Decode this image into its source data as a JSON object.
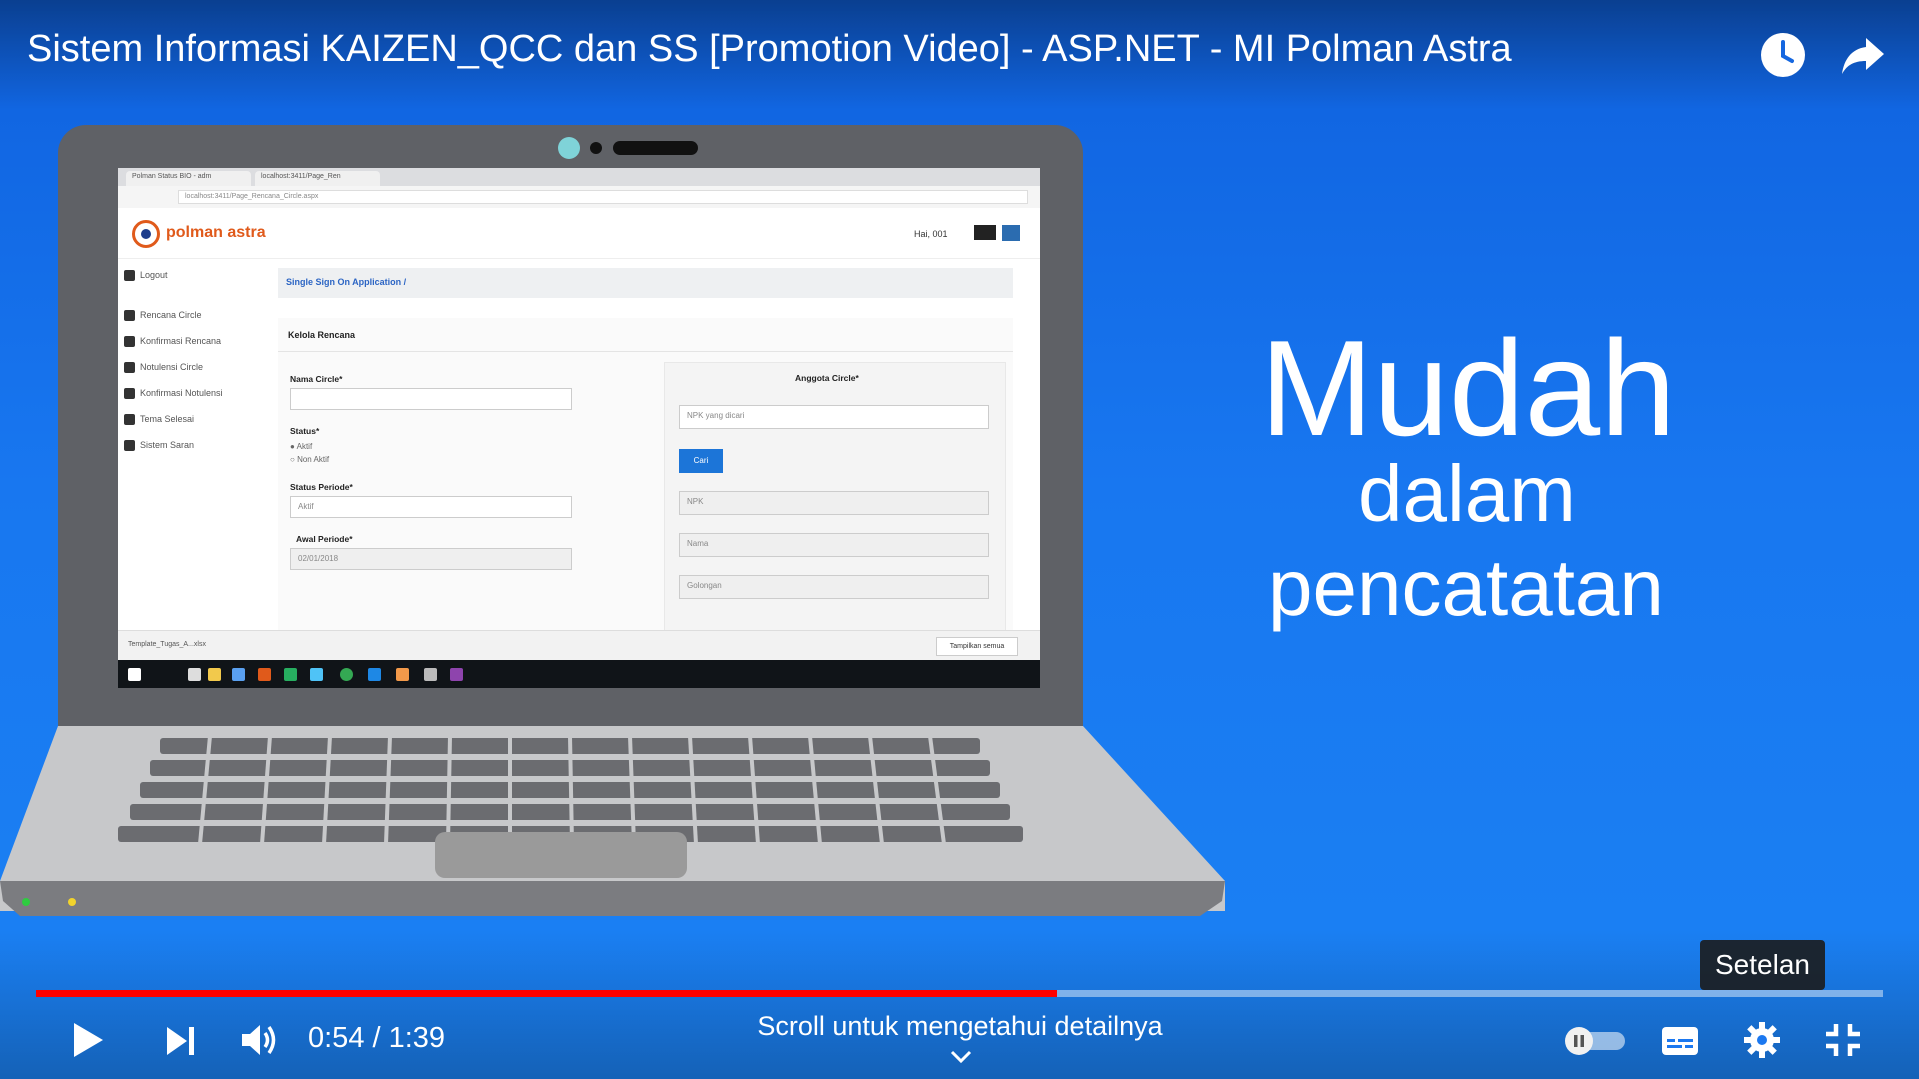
{
  "video": {
    "title": "Sistem Informasi KAIZEN_QCC dan SS [Promotion Video] - ASP.NET - MI Polman Astra",
    "overlay_lines": [
      "Mudah",
      "dalam",
      "pencatatan"
    ]
  },
  "top_actions": {
    "watch_later_icon": "clock-icon",
    "share_icon": "share-icon"
  },
  "screen_app": {
    "browser_tabs": [
      "Polman Status BIO - adm",
      "localhost:3411/Page_Ren"
    ],
    "url": "localhost:3411/Page_Rencana_Circle.aspx",
    "logo_text": "polman astra",
    "user_label": "Hai, 001",
    "sidebar": [
      "Logout",
      "Rencana Circle",
      "Konfirmasi Rencana",
      "Notulensi Circle",
      "Konfirmasi Notulensi",
      "Tema Selesai",
      "Sistem Saran"
    ],
    "breadcrumb": "Single Sign On Application  /",
    "panel_title": "Kelola Rencana",
    "fields": {
      "nama_circle_label": "Nama Circle*",
      "status_label": "Status*",
      "status_options": [
        "Aktif",
        "Non Aktif"
      ],
      "status_periode_label": "Status Periode*",
      "status_periode_value": "Aktif",
      "awal_periode_label": "Awal Periode*",
      "awal_periode_value": "02/01/2018"
    },
    "anggota": {
      "title": "Anggota Circle*",
      "search_placeholder": "NPK yang dicari",
      "cari_label": "Cari",
      "npk_placeholder": "NPK",
      "nama_placeholder": "Nama",
      "golongan_placeholder": "Golongan"
    },
    "download_file": "Template_Tugas_A...xlsx",
    "show_all_label": "Tampilkan semua"
  },
  "player": {
    "progress_fraction": 0.553,
    "current_time": "0:54",
    "duration": "1:39",
    "time_display": "0:54 / 1:39",
    "tooltip": "Setelan",
    "scroll_hint": "Scroll untuk mengetahui detailnya",
    "autoplay_on": false,
    "colors": {
      "progress": "#ff0000",
      "background": "#1a73e8"
    }
  }
}
